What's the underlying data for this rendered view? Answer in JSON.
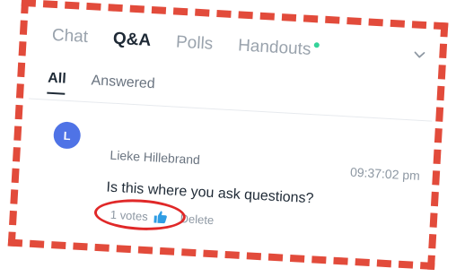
{
  "tabs": [
    {
      "label": "Chat",
      "active": false
    },
    {
      "label": "Q&A",
      "active": true
    },
    {
      "label": "Polls",
      "active": false
    },
    {
      "label": "Handouts",
      "active": false
    }
  ],
  "subtabs": [
    {
      "label": "All",
      "active": true
    },
    {
      "label": "Answered",
      "active": false
    }
  ],
  "question": {
    "avatar_initial": "L",
    "author": "Lieke Hillebrand",
    "time": "09:37:02 pm",
    "text": "Is this where you ask questions?",
    "votes_label": "1 votes",
    "delete_label": "Delete"
  },
  "colors": {
    "frame": "#e24b3b",
    "annotation_circle": "#e02828",
    "avatar": "#4f73e6",
    "thumb": "#2f9de4",
    "notification_dot": "#35d39a"
  },
  "icons": {
    "expand": "chevron-down-icon",
    "vote": "thumbs-up-icon"
  }
}
